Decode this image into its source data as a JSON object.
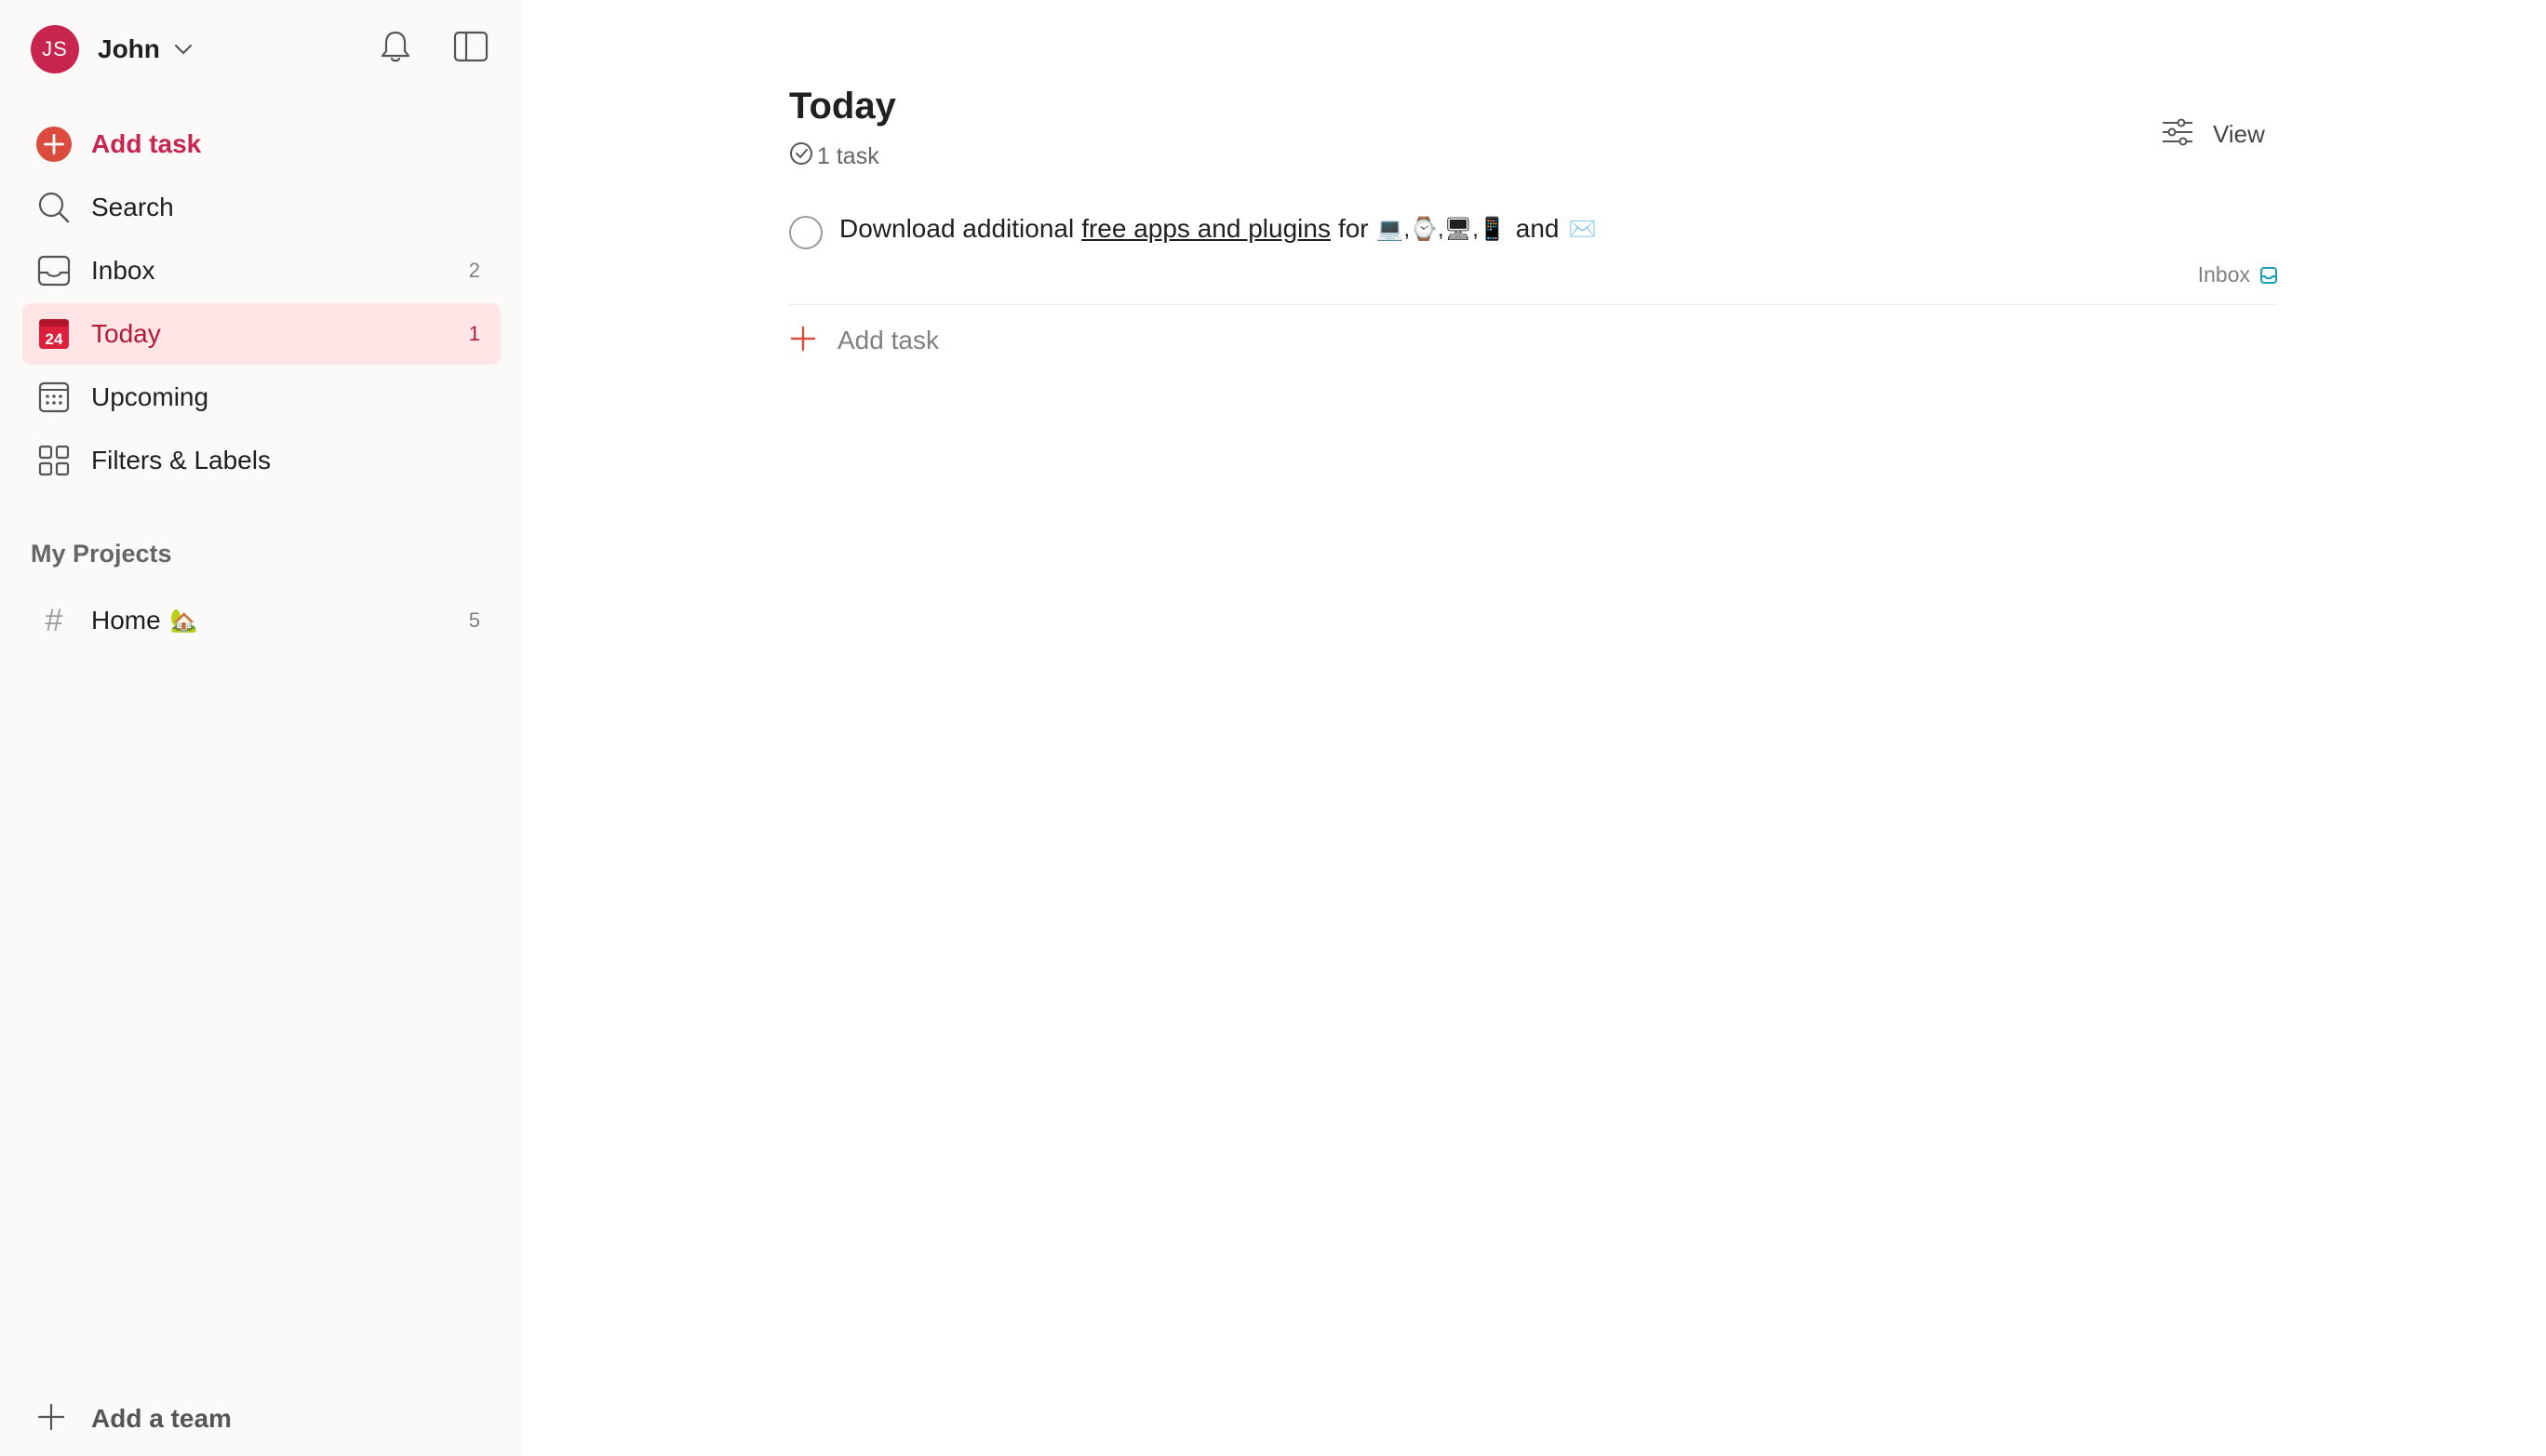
{
  "user": {
    "initials": "JS",
    "name": "John"
  },
  "sidebar": {
    "add_task": "Add task",
    "items": [
      {
        "label": "Search",
        "count": ""
      },
      {
        "label": "Inbox",
        "count": "2"
      },
      {
        "label": "Today",
        "count": "1",
        "calendar_day": "24"
      },
      {
        "label": "Upcoming",
        "count": ""
      },
      {
        "label": "Filters & Labels",
        "count": ""
      }
    ],
    "projects_title": "My Projects",
    "projects": [
      {
        "label": "Home",
        "emoji": "🏡",
        "count": "5"
      }
    ],
    "add_team": "Add a team"
  },
  "main": {
    "title": "Today",
    "task_count": "1 task",
    "view_label": "View",
    "tasks": [
      {
        "text_before": "Download additional",
        "link_text": "free apps and plugins",
        "text_after": "for",
        "emojis": "💻,⌚,🖥,📱",
        "text_and": "and",
        "emoji_last": "✉️",
        "project": "Inbox"
      }
    ],
    "add_task_label": "Add task"
  },
  "colors": {
    "accent": "#dc4c3e",
    "brand": "#c7254e",
    "active_bg": "#ffe5e6",
    "sidebar_bg": "#fcfaf8"
  },
  "icons": [
    "chevron-down-icon",
    "bell-icon",
    "sidebar-toggle-icon",
    "plus-circle-icon",
    "search-icon",
    "inbox-icon",
    "calendar-today-icon",
    "calendar-grid-icon",
    "filters-icon",
    "hash-icon",
    "plus-icon",
    "check-circle-icon",
    "sliders-icon"
  ]
}
